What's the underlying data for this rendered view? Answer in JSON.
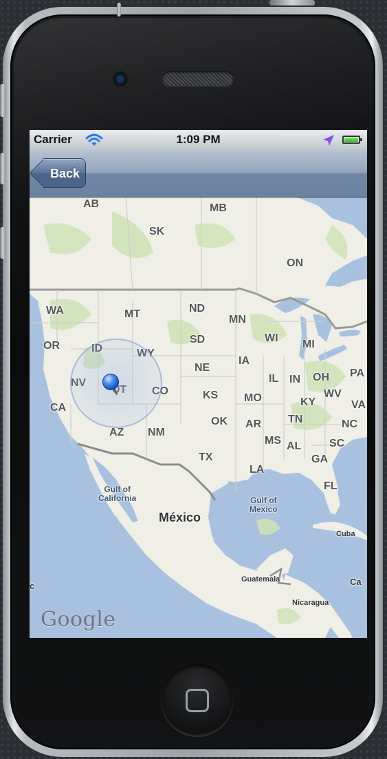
{
  "status_bar": {
    "carrier": "Carrier",
    "time": "1:09 PM",
    "wifi_icon": "wifi-icon",
    "location_icon": "location-arrow-icon",
    "battery_icon": "battery-icon",
    "battery_level": 1.0
  },
  "nav_bar": {
    "back_label": "Back"
  },
  "map": {
    "labels": {
      "ab": "AB",
      "mb": "MB",
      "sk": "SK",
      "on": "ON",
      "wa": "WA",
      "mt": "MT",
      "nd": "ND",
      "mn": "MN",
      "or": "OR",
      "id": "ID",
      "wy": "WY",
      "sd": "SD",
      "wi": "WI",
      "mi": "MI",
      "ne": "NE",
      "ia": "IA",
      "nv": "NV",
      "ut": "UT",
      "co": "CO",
      "ks": "KS",
      "mo": "MO",
      "il": "IL",
      "in": "IN",
      "oh": "OH",
      "pa": "PA",
      "ca": "CA",
      "ky": "KY",
      "wv": "WV",
      "va": "VA",
      "az": "AZ",
      "nm": "NM",
      "ok": "OK",
      "ar": "AR",
      "tn": "TN",
      "nc": "NC",
      "ms": "MS",
      "al": "AL",
      "sc": "SC",
      "ga": "GA",
      "tx": "TX",
      "la": "LA",
      "fl": "FL",
      "gulf_california": "Gulf of\nCalifornia",
      "mexico": "México",
      "gulf_mexico": "Gulf of\nMexico",
      "cuba": "Cuba",
      "guatemala": "Guatemala",
      "nicaragua": "Nicaragua",
      "ca_edge": "Ca",
      "c_edge": "c"
    },
    "logo": "Google",
    "user_pin_icon": "map-pin-icon"
  }
}
